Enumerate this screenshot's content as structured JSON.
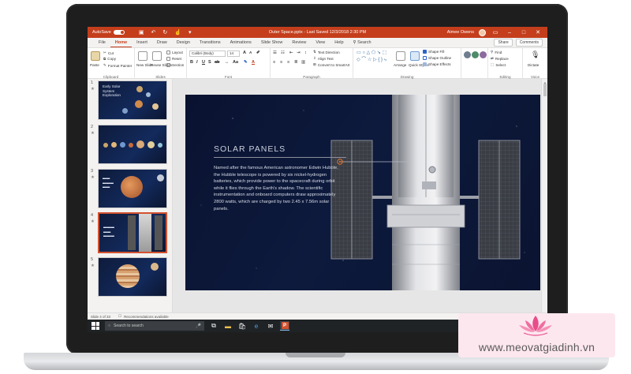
{
  "titlebar": {
    "autosave_label": "AutoSave",
    "autosave_state": "On",
    "doc_title": "Outer Space.pptx  -  Last Saved  12/3/2018  2:30 PM",
    "user_name": "Aimee Owens",
    "minimize": "–",
    "maximize": "□",
    "close": "✕"
  },
  "tabs": [
    "File",
    "Home",
    "Insert",
    "Draw",
    "Design",
    "Transitions",
    "Animations",
    "Slide Show",
    "Review",
    "View",
    "Help",
    "Search"
  ],
  "active_tab": "Home",
  "tab_actions": {
    "share": "Share",
    "comments": "Comments"
  },
  "ribbon": {
    "clipboard": {
      "paste": "Paste",
      "cut": "Cut",
      "copy": "Copy",
      "format_painter": "Format Painter",
      "label": "Clipboard"
    },
    "slides": {
      "new_slide": "New Slide",
      "reuse_slides": "Reuse Slides",
      "layout": "Layout",
      "reset": "Reset",
      "section": "Section",
      "label": "Slides"
    },
    "font": {
      "font_name": "Calibri (Body)",
      "font_size": "14",
      "label": "Font"
    },
    "paragraph": {
      "text_direction": "Text Direction",
      "align_text": "Align Text",
      "convert_smartart": "Convert to SmartArt",
      "label": "Paragraph"
    },
    "drawing": {
      "arrange": "Arrange",
      "quick_styles": "Quick Styles",
      "shape_fill": "Shape Fill",
      "shape_outline": "Shape Outline",
      "shape_effects": "Shape Effects",
      "label": "Drawing"
    },
    "editing": {
      "find": "Find",
      "replace": "Replace",
      "select": "Select",
      "label": "Editing"
    },
    "voice": {
      "dictate": "Dictate",
      "label": "Voice"
    }
  },
  "thumbnails": [
    {
      "num": "1",
      "title": "Early Solar System Exploration"
    },
    {
      "num": "2",
      "title": ""
    },
    {
      "num": "3",
      "title": ""
    },
    {
      "num": "4",
      "title": ""
    },
    {
      "num": "5",
      "title": ""
    }
  ],
  "selected_slide": "4",
  "slide": {
    "heading": "SOLAR PANELS",
    "body": "Named after the famous American astronomer Edwin Hubble, the Hubble telescope is powered by six nickel-hydrogen batteries, which provide power to the spacecraft during orbit while it flies through the Earth's shadow. The scientific instrumentation and onboard computers draw approximately 2800 watts, which are charged by two 2.45 x 7.56m solar panels."
  },
  "statusbar": {
    "slide_info": "Slide 4 of 33",
    "recommendations": "Recommendations available",
    "notes": "Notes"
  },
  "taskbar": {
    "search_placeholder": "Search to search"
  },
  "watermark": {
    "text": "www.meovatgiadinh.vn"
  },
  "colors": {
    "accent": "#c43e1c",
    "selection": "#d35230",
    "slide_bg": "#0d1a3d"
  }
}
